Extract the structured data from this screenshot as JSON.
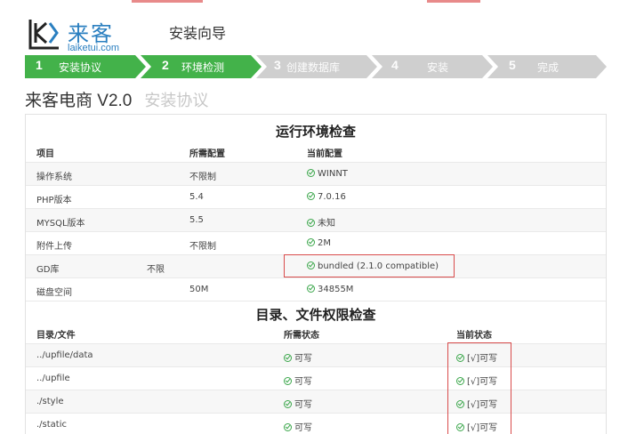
{
  "header": {
    "brand": "来客",
    "domain": "laiketui.com",
    "wizard_title": "安装向导"
  },
  "steps": [
    {
      "num": "1",
      "label": "安装协议",
      "state": "active"
    },
    {
      "num": "2",
      "label": "环境检测",
      "state": "active"
    },
    {
      "num": "3",
      "label": "创建数据库",
      "state": "inactive"
    },
    {
      "num": "4",
      "label": "安装",
      "state": "inactive"
    },
    {
      "num": "5",
      "label": "完成",
      "state": "inactive"
    }
  ],
  "page": {
    "title": "来客电商 V2.0",
    "subtitle": "安装协议"
  },
  "env_check": {
    "title": "运行环境检查",
    "columns": [
      "项目",
      "所需配置",
      "当前配置"
    ],
    "rows": [
      {
        "item": "操作系统",
        "required": "不限制",
        "current": "WINNT"
      },
      {
        "item": "PHP版本",
        "required": "5.4",
        "current": "7.0.16"
      },
      {
        "item": "MYSQL版本",
        "required": "5.5",
        "current": "未知"
      },
      {
        "item": "附件上传",
        "required": "不限制",
        "current": "2M"
      },
      {
        "item": "GD库",
        "required": "不限",
        "current": "bundled (2.1.0 compatible)"
      },
      {
        "item": "磁盘空间",
        "required": "50M",
        "current": "34855M"
      }
    ]
  },
  "perm_check": {
    "title": "目录、文件权限检查",
    "columns": [
      "目录/文件",
      "所需状态",
      "当前状态"
    ],
    "rows": [
      {
        "path": "../upfile/data",
        "required": "可写",
        "current": "[√]可写"
      },
      {
        "path": "../upfile",
        "required": "可写",
        "current": "[√]可写"
      },
      {
        "path": "./style",
        "required": "可写",
        "current": "[√]可写"
      },
      {
        "path": "./static",
        "required": "可写",
        "current": "[√]可写"
      }
    ]
  },
  "colors": {
    "step_active": "#43b24a",
    "step_inactive": "#cfcfcf",
    "ok": "#3aa64a",
    "highlight": "#d94c4c",
    "brand": "#2a7fc0"
  }
}
